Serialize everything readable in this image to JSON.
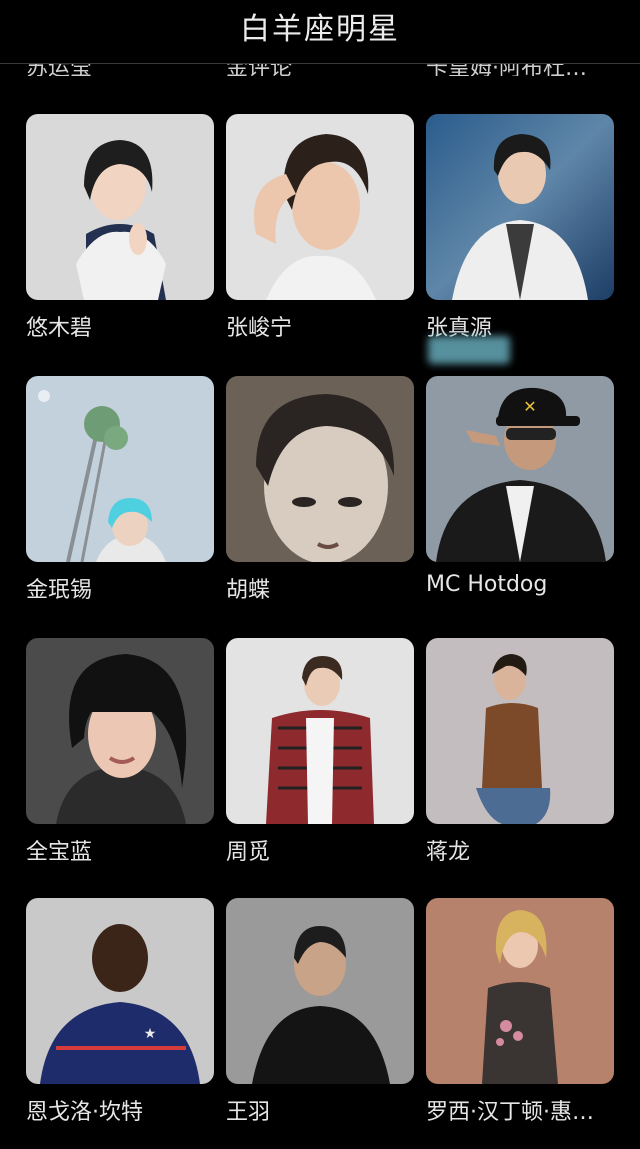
{
  "header": {
    "title": "白羊座明星"
  },
  "cut_row": {
    "labels": [
      "苏运莹",
      "金评论",
      "卡皇姆·阿布杜…"
    ]
  },
  "celebrities": [
    {
      "name": "悠木碧",
      "photo": "portrait-photo-1"
    },
    {
      "name": "张峻宁",
      "photo": "portrait-photo-2"
    },
    {
      "name": "张真源",
      "photo": "portrait-photo-3"
    },
    {
      "name": "金珉锡",
      "photo": "portrait-photo-4"
    },
    {
      "name": "胡蝶",
      "photo": "portrait-photo-5"
    },
    {
      "name": "MC Hotdog",
      "photo": "portrait-photo-6"
    },
    {
      "name": "全宝蓝",
      "photo": "portrait-photo-7"
    },
    {
      "name": "周觅",
      "photo": "portrait-photo-8"
    },
    {
      "name": "蒋龙",
      "photo": "portrait-photo-9"
    },
    {
      "name": "恩戈洛·坎特",
      "photo": "portrait-photo-10"
    },
    {
      "name": "王羽",
      "photo": "portrait-photo-11"
    },
    {
      "name": "罗西·汉丁顿·惠…",
      "photo": "portrait-photo-12"
    }
  ],
  "colors": {
    "background": "#000000",
    "text": "#e6e6e6",
    "card": "#1d1d1d"
  }
}
